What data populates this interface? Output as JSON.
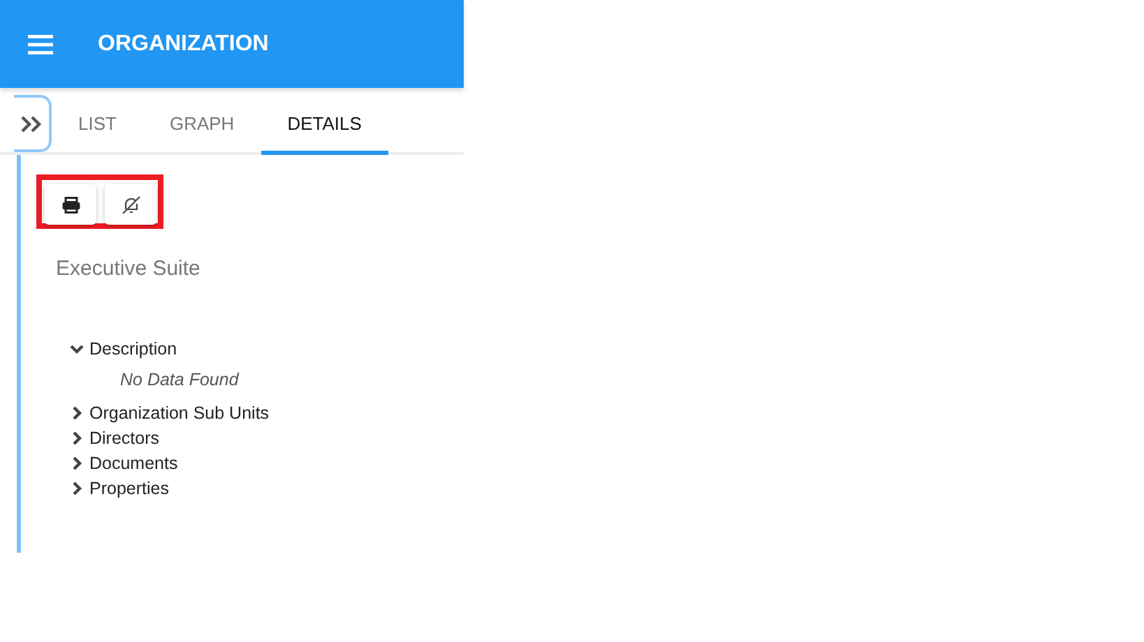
{
  "header": {
    "title": "ORGANIZATION"
  },
  "tabs": [
    {
      "label": "LIST",
      "selected": false
    },
    {
      "label": "GRAPH",
      "selected": false
    },
    {
      "label": "DETAILS",
      "selected": true
    }
  ],
  "title": "Executive Suite",
  "sections": [
    {
      "label": "Description",
      "expanded": true,
      "empty_text": "No Data Found"
    },
    {
      "label": "Organization Sub Units",
      "expanded": false
    },
    {
      "label": "Directors",
      "expanded": false
    },
    {
      "label": "Documents",
      "expanded": false
    },
    {
      "label": "Properties",
      "expanded": false
    }
  ]
}
